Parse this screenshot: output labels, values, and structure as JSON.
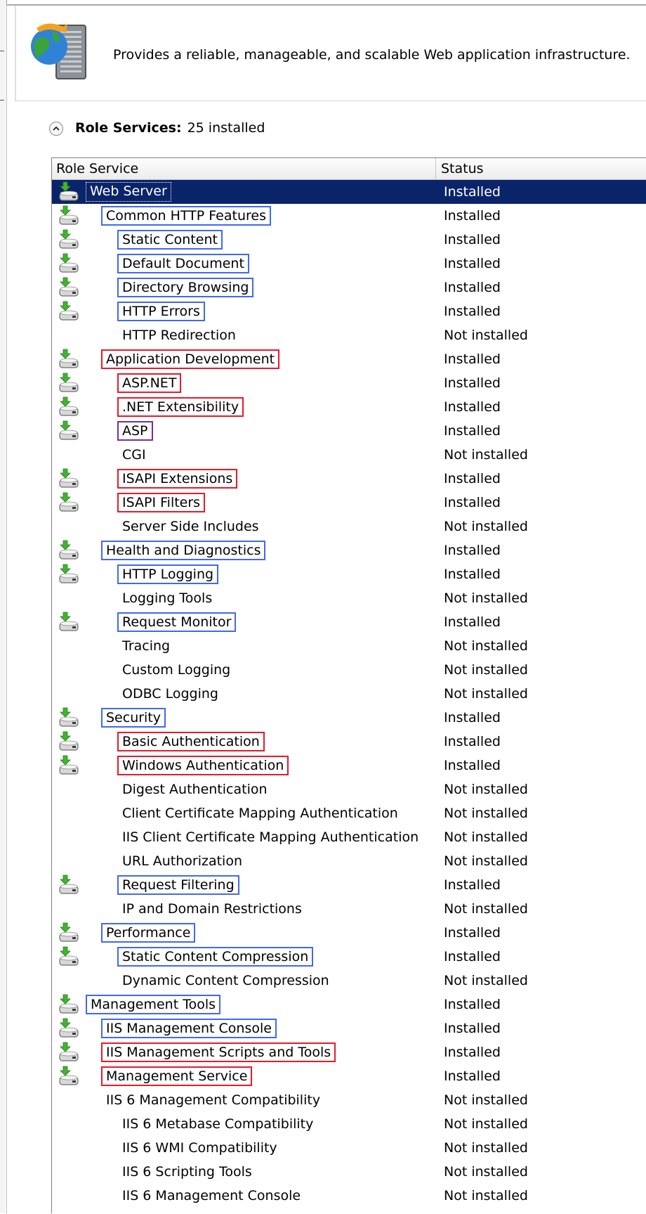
{
  "header": {
    "description": "Provides a reliable, manageable, and scalable Web application infrastructure."
  },
  "role_services": {
    "title": "Role Services:",
    "count_text": "25 installed"
  },
  "columns": {
    "role_service": "Role Service",
    "status": "Status"
  },
  "rows": [
    {
      "name": "Web Server",
      "status": "Installed",
      "level": 0,
      "icon": true,
      "box": "none",
      "selected": true
    },
    {
      "name": "Common HTTP Features",
      "status": "Installed",
      "level": 1,
      "icon": true,
      "box": "blue"
    },
    {
      "name": "Static Content",
      "status": "Installed",
      "level": 2,
      "icon": true,
      "box": "blue"
    },
    {
      "name": "Default Document",
      "status": "Installed",
      "level": 2,
      "icon": true,
      "box": "blue"
    },
    {
      "name": "Directory Browsing",
      "status": "Installed",
      "level": 2,
      "icon": true,
      "box": "blue"
    },
    {
      "name": "HTTP Errors",
      "status": "Installed",
      "level": 2,
      "icon": true,
      "box": "blue"
    },
    {
      "name": "HTTP Redirection",
      "status": "Not installed",
      "level": 2,
      "icon": false,
      "box": "none"
    },
    {
      "name": "Application Development",
      "status": "Installed",
      "level": 1,
      "icon": true,
      "box": "red"
    },
    {
      "name": "ASP.NET",
      "status": "Installed",
      "level": 2,
      "icon": true,
      "box": "red"
    },
    {
      "name": ".NET Extensibility",
      "status": "Installed",
      "level": 2,
      "icon": true,
      "box": "red"
    },
    {
      "name": "ASP",
      "status": "Installed",
      "level": 2,
      "icon": true,
      "box": "purple"
    },
    {
      "name": "CGI",
      "status": "Not installed",
      "level": 2,
      "icon": false,
      "box": "none"
    },
    {
      "name": "ISAPI Extensions",
      "status": "Installed",
      "level": 2,
      "icon": true,
      "box": "red"
    },
    {
      "name": "ISAPI Filters",
      "status": "Installed",
      "level": 2,
      "icon": true,
      "box": "red"
    },
    {
      "name": "Server Side Includes",
      "status": "Not installed",
      "level": 2,
      "icon": false,
      "box": "none"
    },
    {
      "name": "Health and Diagnostics",
      "status": "Installed",
      "level": 1,
      "icon": true,
      "box": "blue"
    },
    {
      "name": "HTTP Logging",
      "status": "Installed",
      "level": 2,
      "icon": true,
      "box": "blue"
    },
    {
      "name": "Logging Tools",
      "status": "Not installed",
      "level": 2,
      "icon": false,
      "box": "none"
    },
    {
      "name": "Request Monitor",
      "status": "Installed",
      "level": 2,
      "icon": true,
      "box": "blue"
    },
    {
      "name": "Tracing",
      "status": "Not installed",
      "level": 2,
      "icon": false,
      "box": "none"
    },
    {
      "name": "Custom Logging",
      "status": "Not installed",
      "level": 2,
      "icon": false,
      "box": "none"
    },
    {
      "name": "ODBC Logging",
      "status": "Not installed",
      "level": 2,
      "icon": false,
      "box": "none"
    },
    {
      "name": "Security",
      "status": "Installed",
      "level": 1,
      "icon": true,
      "box": "blue"
    },
    {
      "name": "Basic Authentication",
      "status": "Installed",
      "level": 2,
      "icon": true,
      "box": "red"
    },
    {
      "name": "Windows Authentication",
      "status": "Installed",
      "level": 2,
      "icon": true,
      "box": "red"
    },
    {
      "name": "Digest Authentication",
      "status": "Not installed",
      "level": 2,
      "icon": false,
      "box": "none"
    },
    {
      "name": "Client Certificate Mapping Authentication",
      "status": "Not installed",
      "level": 2,
      "icon": false,
      "box": "none"
    },
    {
      "name": "IIS Client Certificate Mapping Authentication",
      "status": "Not installed",
      "level": 2,
      "icon": false,
      "box": "none"
    },
    {
      "name": "URL Authorization",
      "status": "Not installed",
      "level": 2,
      "icon": false,
      "box": "none"
    },
    {
      "name": "Request Filtering",
      "status": "Installed",
      "level": 2,
      "icon": true,
      "box": "blue"
    },
    {
      "name": "IP and Domain Restrictions",
      "status": "Not installed",
      "level": 2,
      "icon": false,
      "box": "none"
    },
    {
      "name": "Performance",
      "status": "Installed",
      "level": 1,
      "icon": true,
      "box": "blue"
    },
    {
      "name": "Static Content Compression",
      "status": "Installed",
      "level": 2,
      "icon": true,
      "box": "blue"
    },
    {
      "name": "Dynamic Content Compression",
      "status": "Not installed",
      "level": 2,
      "icon": false,
      "box": "none"
    },
    {
      "name": "Management Tools",
      "status": "Installed",
      "level": 0,
      "icon": true,
      "box": "blue"
    },
    {
      "name": "IIS Management Console",
      "status": "Installed",
      "level": 1,
      "icon": true,
      "box": "blue"
    },
    {
      "name": "IIS Management Scripts and Tools",
      "status": "Installed",
      "level": 1,
      "icon": true,
      "box": "red"
    },
    {
      "name": "Management Service",
      "status": "Installed",
      "level": 1,
      "icon": true,
      "box": "red"
    },
    {
      "name": "IIS 6 Management Compatibility",
      "status": "Not installed",
      "level": 1,
      "icon": false,
      "box": "none"
    },
    {
      "name": "IIS 6 Metabase Compatibility",
      "status": "Not installed",
      "level": 2,
      "icon": false,
      "box": "none"
    },
    {
      "name": "IIS 6 WMI Compatibility",
      "status": "Not installed",
      "level": 2,
      "icon": false,
      "box": "none"
    },
    {
      "name": "IIS 6 Scripting Tools",
      "status": "Not installed",
      "level": 2,
      "icon": false,
      "box": "none"
    },
    {
      "name": "IIS 6 Management Console",
      "status": "Not installed",
      "level": 2,
      "icon": false,
      "box": "none"
    }
  ]
}
